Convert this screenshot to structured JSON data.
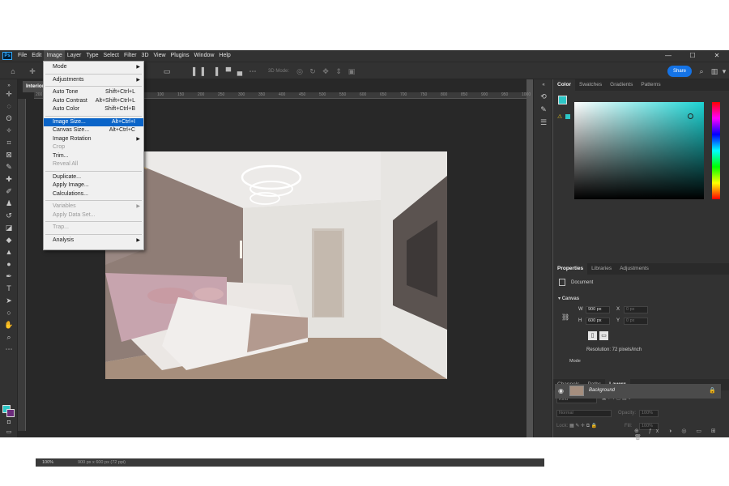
{
  "menubar": {
    "items": [
      "File",
      "Edit",
      "Image",
      "Layer",
      "Type",
      "Select",
      "Filter",
      "3D",
      "View",
      "Plugins",
      "Window",
      "Help"
    ],
    "active_index": 2
  },
  "window_controls": [
    "—",
    "☐",
    "✕"
  ],
  "options_bar": {
    "mode_3d": "3D Mode:",
    "share_label": "Share"
  },
  "document": {
    "tab_title": "Interior",
    "ruler_marks": [
      "200",
      "150",
      "100",
      "50",
      "0",
      "50",
      "100",
      "150",
      "200",
      "250",
      "300",
      "350",
      "400",
      "450",
      "500",
      "550",
      "600",
      "650",
      "700",
      "750",
      "800",
      "850",
      "900",
      "950",
      "1000",
      "1050"
    ],
    "status_zoom": "100%",
    "status_info": "900 px x 600 px (72 ppi)"
  },
  "image_menu": {
    "items": [
      {
        "label": "Mode",
        "shortcut": "",
        "submenu": true,
        "disabled": false,
        "highlight": false
      },
      {
        "sep": true
      },
      {
        "label": "Adjustments",
        "shortcut": "",
        "submenu": true,
        "disabled": false,
        "highlight": false
      },
      {
        "sep": true
      },
      {
        "label": "Auto Tone",
        "shortcut": "Shift+Ctrl+L",
        "submenu": false,
        "disabled": false,
        "highlight": false
      },
      {
        "label": "Auto Contrast",
        "shortcut": "Alt+Shift+Ctrl+L",
        "submenu": false,
        "disabled": false,
        "highlight": false
      },
      {
        "label": "Auto Color",
        "shortcut": "Shift+Ctrl+B",
        "submenu": false,
        "disabled": false,
        "highlight": false
      },
      {
        "sep": true
      },
      {
        "label": "Image Size...",
        "shortcut": "Alt+Ctrl+I",
        "submenu": false,
        "disabled": false,
        "highlight": true
      },
      {
        "label": "Canvas Size...",
        "shortcut": "Alt+Ctrl+C",
        "submenu": false,
        "disabled": false,
        "highlight": false
      },
      {
        "label": "Image Rotation",
        "shortcut": "",
        "submenu": true,
        "disabled": false,
        "highlight": false
      },
      {
        "label": "Crop",
        "shortcut": "",
        "submenu": false,
        "disabled": true,
        "highlight": false
      },
      {
        "label": "Trim...",
        "shortcut": "",
        "submenu": false,
        "disabled": false,
        "highlight": false
      },
      {
        "label": "Reveal All",
        "shortcut": "",
        "submenu": false,
        "disabled": true,
        "highlight": false
      },
      {
        "sep": true
      },
      {
        "label": "Duplicate...",
        "shortcut": "",
        "submenu": false,
        "disabled": false,
        "highlight": false
      },
      {
        "label": "Apply Image...",
        "shortcut": "",
        "submenu": false,
        "disabled": false,
        "highlight": false
      },
      {
        "label": "Calculations...",
        "shortcut": "",
        "submenu": false,
        "disabled": false,
        "highlight": false
      },
      {
        "sep": true
      },
      {
        "label": "Variables",
        "shortcut": "",
        "submenu": true,
        "disabled": true,
        "highlight": false
      },
      {
        "label": "Apply Data Set...",
        "shortcut": "",
        "submenu": false,
        "disabled": true,
        "highlight": false
      },
      {
        "sep": true
      },
      {
        "label": "Trap...",
        "shortcut": "",
        "submenu": false,
        "disabled": true,
        "highlight": false
      },
      {
        "sep": true
      },
      {
        "label": "Analysis",
        "shortcut": "",
        "submenu": true,
        "disabled": false,
        "highlight": false
      }
    ]
  },
  "color_panel": {
    "tabs": [
      "Color",
      "Swatches",
      "Gradients",
      "Patterns"
    ],
    "foreground": "#2dc6c6",
    "background": "#6b2b7b"
  },
  "properties_panel": {
    "tabs": [
      "Properties",
      "Libraries",
      "Adjustments"
    ],
    "doc_label": "Document",
    "section": "Canvas",
    "w_label": "W",
    "w_value": "900 px",
    "h_label": "H",
    "h_value": "600 px",
    "x_label": "X",
    "x_value": "0 px",
    "y_label": "Y",
    "y_value": "0 px",
    "resolution": "Resolution: 72 pixels/inch",
    "mode_label": "Mode"
  },
  "layers_panel": {
    "tabs": [
      "Channels",
      "Paths",
      "Layers"
    ],
    "kind": "Kind",
    "blend": "Normal",
    "opacity_label": "Opacity:",
    "opacity_value": "100%",
    "lock_label": "Lock:",
    "fill_label": "Fill:",
    "fill_value": "100%",
    "layer_name": "Background"
  }
}
